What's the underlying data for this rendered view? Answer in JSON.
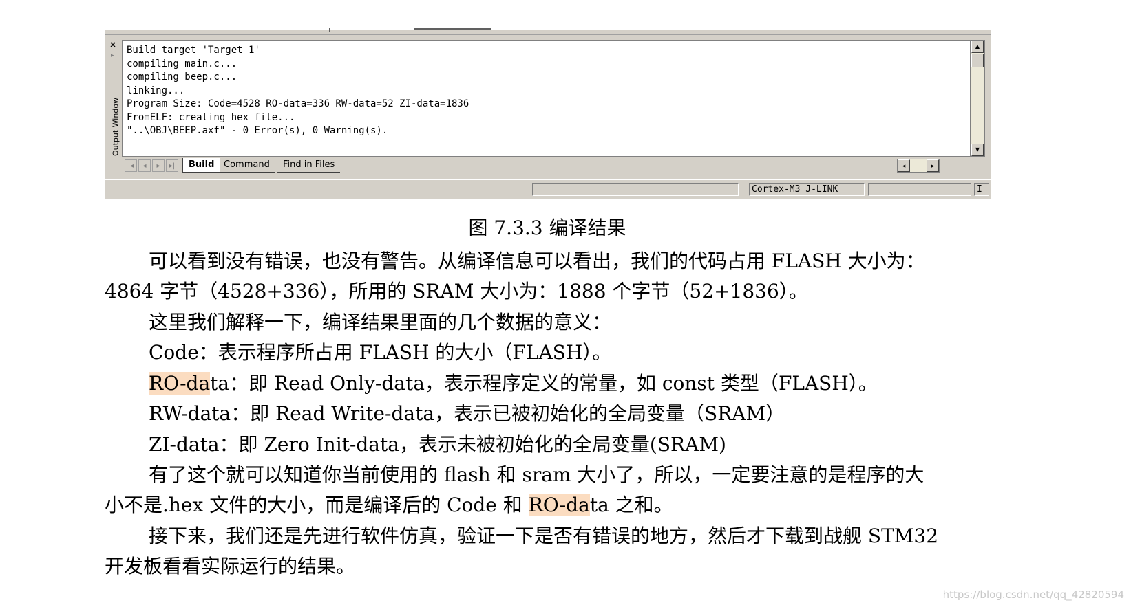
{
  "output_window": {
    "side_label": "Output Window",
    "close_glyph": "×",
    "lines": [
      "Build target 'Target 1'",
      "compiling main.c...",
      "compiling beep.c...",
      "linking...",
      "Program Size: Code=4528 RO-data=336 RW-data=52 ZI-data=1836",
      "FromELF: creating hex file...",
      "\"..\\OBJ\\BEEP.axf\" - 0 Error(s), 0 Warning(s)."
    ],
    "tabs": [
      "Build",
      "Command",
      "Find in Files"
    ],
    "active_tab": "Build",
    "status": {
      "debugger": "Cortex-M3 J-LINK",
      "mode": "I"
    }
  },
  "document": {
    "caption": "图 7.3.3  编译结果",
    "paragraphs": {
      "p1_line1": "可以看到没有错误，也没有警告。从编译信息可以看出，我们的代码占用 FLASH 大小为：",
      "p1_line2": "4864 字节（4528+336），所用的 SRAM 大小为：1888 个字节（52+1836）。",
      "p2": "这里我们解释一下，编译结果里面的几个数据的意义：",
      "p3": "Code：表示程序所占用 FLASH 的大小（FLASH）。",
      "p4_highlight": "RO-da",
      "p4_rest": "ta：即 Read Only-data，表示程序定义的常量，如 const 类型（FLASH）。",
      "p5": "RW-data：即 Read Write-data，表示已被初始化的全局变量（SRAM）",
      "p6": "ZI-data：即 Zero Init-data，表示未被初始化的全局变量(SRAM)",
      "p7_line1": "有了这个就可以知道你当前使用的 flash 和 sram 大小了，所以，一定要注意的是程序的大",
      "p7_line2_a": "小不是.hex 文件的大小，而是编译后的 Code 和 ",
      "p7_line2_highlight": "RO-da",
      "p7_line2_b": "ta 之和。",
      "p8_line1": "接下来，我们还是先进行软件仿真，验证一下是否有错误的地方，然后才下载到战舰 STM32",
      "p8_line2": "开发板看看实际运行的结果。"
    }
  },
  "watermark": "https://blog.csdn.net/qq_42820594"
}
